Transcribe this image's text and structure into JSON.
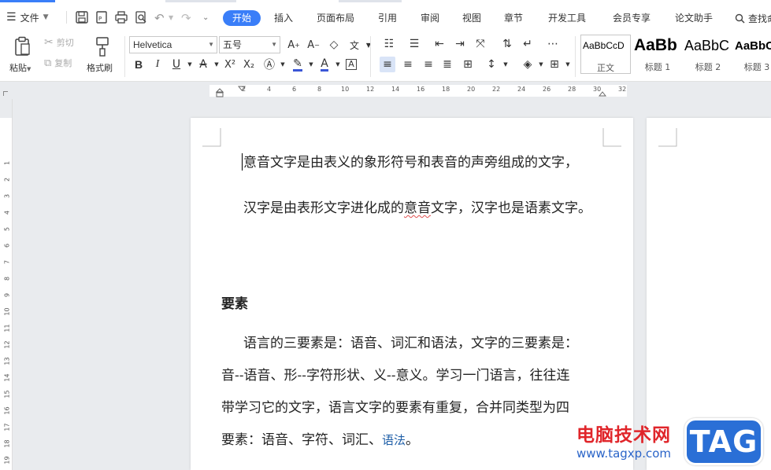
{
  "menubar": {
    "file_label": "文件",
    "tabs": [
      "开始",
      "插入",
      "页面布局",
      "引用",
      "审阅",
      "视图",
      "章节",
      "开发工具",
      "会员专享",
      "论文助手"
    ],
    "active_tab": "开始",
    "search_label": "查找命"
  },
  "ribbon": {
    "paste_label": "粘贴",
    "cut_label": "剪切",
    "copy_label": "复制",
    "format_painter_label": "格式刷",
    "font_name": "Helvetica",
    "font_size": "五号",
    "styles": [
      {
        "preview": "AaBbCcD",
        "name": "正文"
      },
      {
        "preview": "AaBb",
        "name": "标题 1"
      },
      {
        "preview": "AaBbC",
        "name": "标题 2"
      },
      {
        "preview": "AaBbC",
        "name": "标题 3"
      }
    ]
  },
  "ruler": {
    "h_ticks": [
      "2",
      "4",
      "6",
      "8",
      "10",
      "12",
      "14",
      "16",
      "18",
      "20",
      "22",
      "24",
      "26",
      "28",
      "30",
      "32"
    ],
    "v_ticks": [
      "1",
      "2",
      "3",
      "4",
      "5",
      "6",
      "7",
      "8",
      "9",
      "10",
      "11",
      "12",
      "13",
      "14",
      "15",
      "16",
      "17",
      "18",
      "19"
    ],
    "v_top": "1"
  },
  "document": {
    "line1": "意音文字是由表义的象形符号和表音的声旁组成的文字，",
    "line2_a": "汉字是由表形文字进化成的",
    "line2_b": "意音",
    "line2_c": "文字，汉字也是语素文字。",
    "heading": "要素",
    "p_line1": "语言的三要素是：语音、词汇和语法，文字的三要素是：",
    "p_line2": "音--语音、形--字符形状、义--意义。学习一门语言，往往连",
    "p_line3": "带学习它的文字，语言文字的要素有重复，合并同类型为四",
    "p_line4_a": "要素：语音、字符、词汇、",
    "p_line4_b": "语法",
    "p_line4_c": "。"
  },
  "watermark": {
    "title": "电脑技术网",
    "url": "www.tagxp.com",
    "tag": "TAG"
  },
  "colors": {
    "accent": "#3a7ef8",
    "watermark_red": "#e0252a",
    "watermark_blue": "#2a6fd6"
  }
}
